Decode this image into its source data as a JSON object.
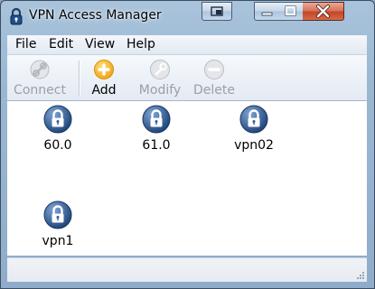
{
  "window": {
    "title": "VPN Access Manager",
    "icon": "padlock-app-icon"
  },
  "titlebar_buttons": [
    "extra-window-icon",
    "minimize-icon",
    "maximize-icon",
    "close-icon"
  ],
  "menu": {
    "items": [
      "File",
      "Edit",
      "View",
      "Help"
    ]
  },
  "toolbar": {
    "buttons": [
      {
        "label": "Connect",
        "icon": "connect-icon",
        "enabled": false
      },
      {
        "label": "Add",
        "icon": "add-icon",
        "enabled": true
      },
      {
        "label": "Modify",
        "icon": "wrench-icon",
        "enabled": false
      },
      {
        "label": "Delete",
        "icon": "minus-icon",
        "enabled": false
      }
    ]
  },
  "connections": [
    {
      "name": "60.0",
      "icon": "padlock-icon"
    },
    {
      "name": "61.0",
      "icon": "padlock-icon"
    },
    {
      "name": "vpn02",
      "icon": "padlock-icon"
    },
    {
      "name": "vpn1",
      "icon": "padlock-icon"
    }
  ],
  "colors": {
    "add_accent": "#f4b520",
    "lock_blue": "#2a5d9c",
    "close_red": "#c44427"
  }
}
